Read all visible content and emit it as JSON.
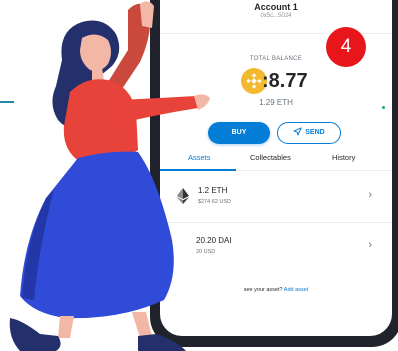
{
  "header": {
    "account_name": "Account 1",
    "account_address": "0x5c...5024",
    "menu_icon": "more-dots-icon"
  },
  "notification": {
    "count": "4",
    "color": "#e8151b"
  },
  "balance": {
    "label": "TOTAL BALANCE",
    "value": "28.77",
    "value_display": ":8.77",
    "eth": "1.29 ETH",
    "coin_icon": "binance-coin-icon",
    "coin_color": "#f3ba2f"
  },
  "actions": {
    "buy_label": "BUY",
    "send_label": "SEND",
    "send_icon": "paper-plane-icon",
    "accent_color": "#037dd6"
  },
  "tabs": [
    {
      "label": "Assets",
      "active": true
    },
    {
      "label": "Collectables",
      "active": false
    },
    {
      "label": "History",
      "active": false
    }
  ],
  "assets": [
    {
      "amount": "1.2 ETH",
      "usd": "$274.62 USD",
      "icon": "ethereum-icon"
    },
    {
      "amount": "20.20 DAI",
      "amount_display": "20.20 DAI",
      "usd": "20 USD",
      "icon": "dai-icon"
    }
  ],
  "footer": {
    "prefix": "see your asset?",
    "link": "Add asset"
  },
  "illustration": {
    "description_icon": "woman-waving-illustration"
  }
}
